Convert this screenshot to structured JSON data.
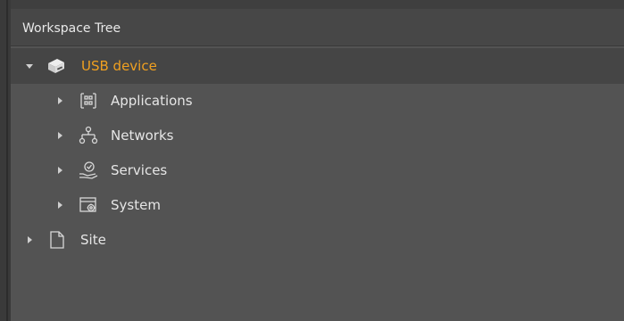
{
  "panel": {
    "title": "Workspace Tree"
  },
  "tree": {
    "root": {
      "label": "USB device",
      "icon": "device-icon",
      "expanded": true,
      "selected": true,
      "children": [
        {
          "label": "Applications",
          "icon": "applications-icon"
        },
        {
          "label": "Networks",
          "icon": "networks-icon"
        },
        {
          "label": "Services",
          "icon": "services-icon"
        },
        {
          "label": "System",
          "icon": "system-icon"
        }
      ]
    },
    "site": {
      "label": "Site",
      "icon": "document-icon"
    }
  },
  "colors": {
    "background": "#535353",
    "header": "#474747",
    "selected_row": "#454545",
    "active_text": "#f0a020",
    "text": "#e6e6e6"
  }
}
